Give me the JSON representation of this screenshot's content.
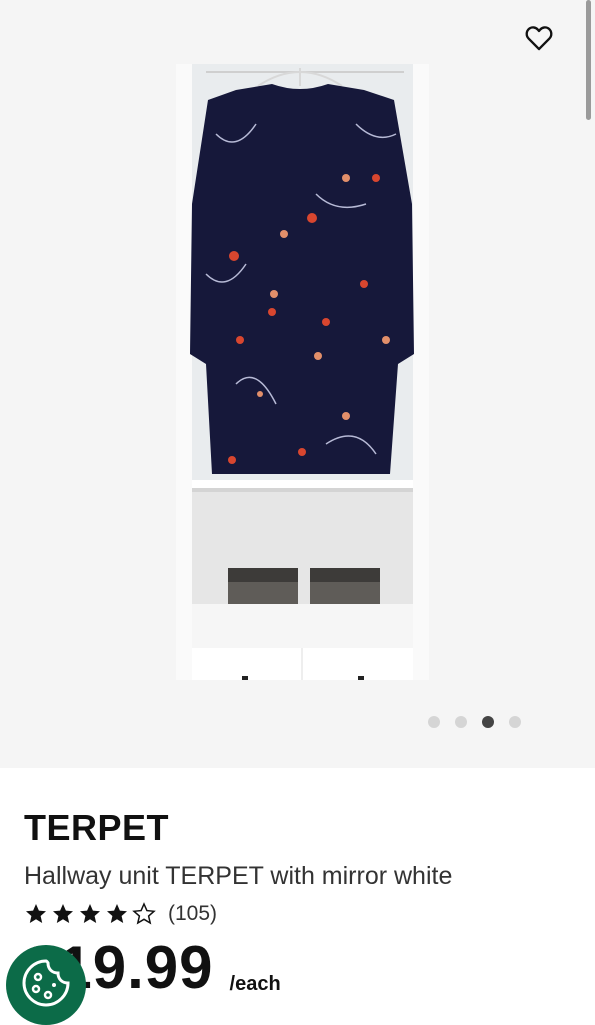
{
  "product": {
    "name": "TERPET",
    "description": "Hallway unit TERPET with mirror white",
    "rating": 4,
    "rating_max": 5,
    "review_count": "(105)",
    "price": "219.99",
    "price_unit": "/each"
  },
  "gallery": {
    "image_count": 4,
    "active_index": 2
  },
  "icons": {
    "wishlist": "heart-outline-icon",
    "cookie": "cookie-settings-icon",
    "star": "star-icon"
  },
  "colors": {
    "brand_green": "#0c6b48",
    "dot_active": "#444444",
    "dot_inactive": "#d5d5d5"
  }
}
